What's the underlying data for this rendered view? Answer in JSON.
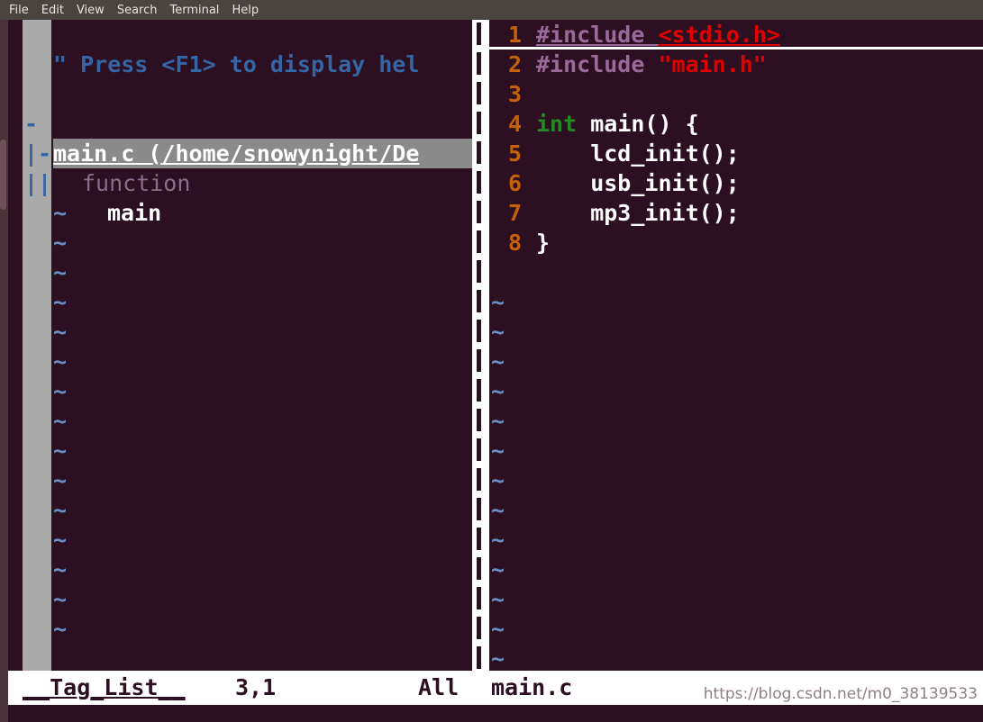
{
  "window": {
    "title": "Terminal",
    "colors": {
      "background": "#2d0f22",
      "menubar": "#4a4440",
      "gutter": "#aaaaaa",
      "statusline_bg": "#ffffff",
      "line_number": "#c4620a",
      "comment_blue": "#3465a4",
      "string_red": "#e00000",
      "preproc_purple": "#9a6a9a",
      "type_green": "#228b22",
      "tilde_blue": "#6a8fc4"
    }
  },
  "menubar": {
    "items": [
      {
        "label": "File"
      },
      {
        "label": "Edit"
      },
      {
        "label": "View"
      },
      {
        "label": "Search"
      },
      {
        "label": "Terminal"
      },
      {
        "label": "Help"
      }
    ]
  },
  "taglist": {
    "help_line": "\" Press <F1> to display hel",
    "blank_line": "",
    "file_entry": {
      "guide": "-",
      "label": "main.c (/home/snowynight/De"
    },
    "kind_entry": {
      "guide": "|-",
      "label": "function"
    },
    "tag_entry": {
      "guide": "||",
      "label": "main"
    },
    "tilde": "~",
    "tilde_count": 15
  },
  "divider": {
    "glyph": "|",
    "count": 22
  },
  "code": {
    "lines": [
      {
        "number": "1",
        "cursorline": true,
        "tokens": [
          {
            "text": "#include ",
            "class": "tok-pre u"
          },
          {
            "text": "<stdio.h>",
            "class": "tok-str u"
          }
        ]
      },
      {
        "number": "2",
        "cursorline": false,
        "tokens": [
          {
            "text": "#include ",
            "class": "tok-pre"
          },
          {
            "text": "\"main.h\"",
            "class": "tok-str"
          }
        ]
      },
      {
        "number": "3",
        "cursorline": false,
        "tokens": []
      },
      {
        "number": "4",
        "cursorline": false,
        "tokens": [
          {
            "text": "int ",
            "class": "tok-type"
          },
          {
            "text": "main() {",
            "class": "tok-plain"
          }
        ]
      },
      {
        "number": "5",
        "cursorline": false,
        "tokens": [
          {
            "text": "    lcd_init();",
            "class": "tok-plain"
          }
        ]
      },
      {
        "number": "6",
        "cursorline": false,
        "tokens": [
          {
            "text": "    usb_init();",
            "class": "tok-plain"
          }
        ]
      },
      {
        "number": "7",
        "cursorline": false,
        "tokens": [
          {
            "text": "    mp3_init();",
            "class": "tok-plain"
          }
        ]
      },
      {
        "number": "8",
        "cursorline": false,
        "tokens": [
          {
            "text": "}",
            "class": "tok-plain"
          }
        ]
      }
    ],
    "tilde": "~",
    "tilde_count": 14
  },
  "statusline": {
    "taglist_name": "__Tag_List__",
    "cursor_position": "3,1",
    "scroll_indicator": "All",
    "file_name": "main.c"
  },
  "watermark": {
    "text": "https://blog.csdn.net/m0_38139533"
  }
}
